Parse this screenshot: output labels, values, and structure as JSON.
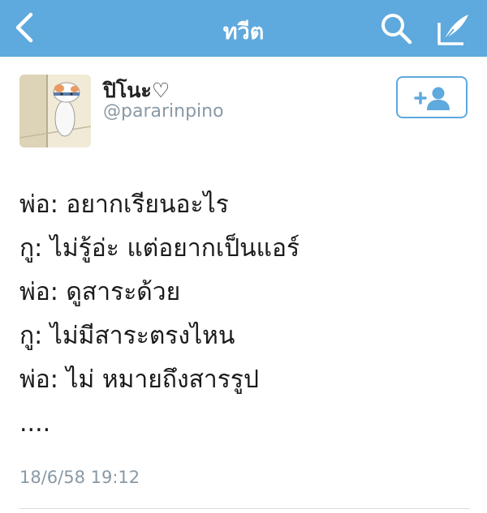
{
  "nav": {
    "title": "ทวีต",
    "back_icon": "chevron-left-icon",
    "search_icon": "search-icon",
    "compose_icon": "compose-tweet-icon",
    "bar_color": "#5ea9dd"
  },
  "tweet": {
    "display_name": "ปิโนะ♡",
    "handle": "@pararinpino",
    "follow_icon": "add-user-icon",
    "lines": [
      "พ่อ: อยากเรียนอะไร",
      "กู: ไม่รู้อ่ะ แต่อยากเป็นแอร์",
      "พ่อ: ดูสาระด้วย",
      "กู: ไม่มีสาระตรงไหน",
      "พ่อ: ไม่ หมายถึงสารรูป",
      "...."
    ],
    "timestamp": "18/6/58 19:12"
  }
}
